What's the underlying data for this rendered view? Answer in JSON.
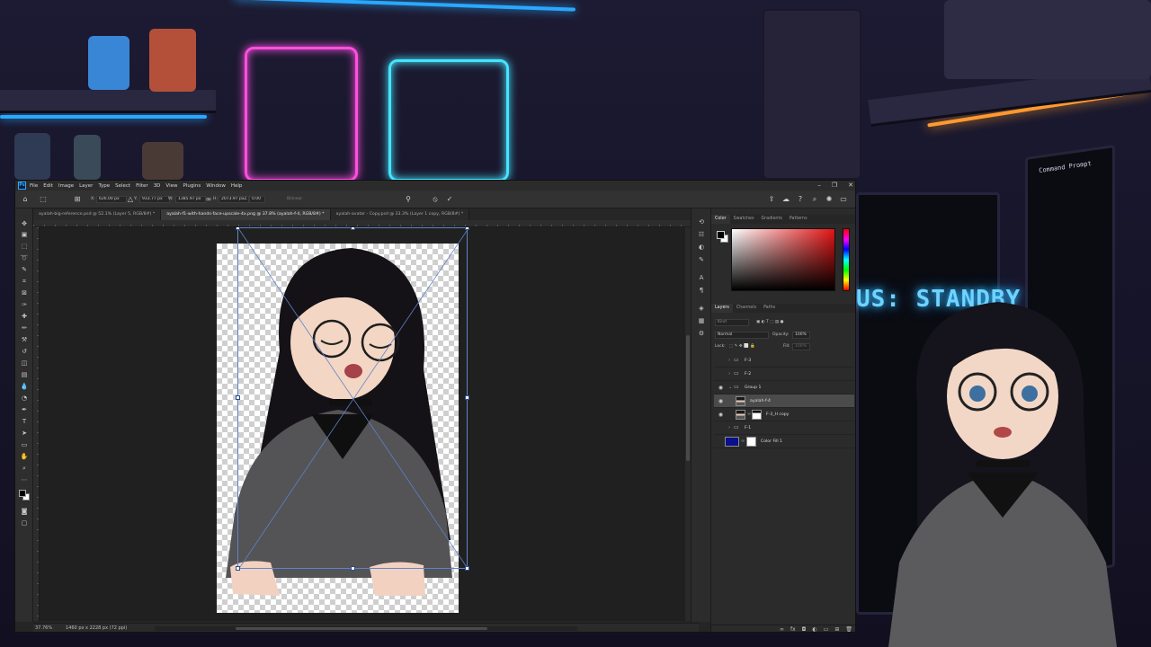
{
  "background": {
    "status_text": "US: STANDBY",
    "terminal_title": "Command Prompt",
    "colors": {
      "neon_pink": "#ff4fe0",
      "neon_cyan": "#45e4ff",
      "neon_blue": "#29a8ff",
      "neon_orange": "#ff9a2e"
    }
  },
  "app": {
    "logo": "Ps",
    "menu": [
      "File",
      "Edit",
      "Image",
      "Layer",
      "Type",
      "Select",
      "Filter",
      "3D",
      "View",
      "Plugins",
      "Window",
      "Help"
    ],
    "window_controls": {
      "minimize": "–",
      "restore": "❐",
      "close": "✕"
    }
  },
  "options_bar": {
    "x_label": "X:",
    "x_value": "626.00 px",
    "y_label": "Y:",
    "y_value": "933.77 px",
    "w_label": "W:",
    "w_value": "1385.97 px",
    "h_label": "H:",
    "h_value": "2073.97 px",
    "angle_label": "∠",
    "angle_value": "0.00",
    "interpolation": "Bilinear",
    "cancel_icon": "⦸",
    "commit_icon": "✓"
  },
  "tabs": [
    {
      "label": "ayalah-big-reference.psd @ 52.1% (Layer 5, RGB/8#) *",
      "active": false
    },
    {
      "label": "ayalah-f1-with-hands-face-upscale-4x.png @ 37.8% (ayalah-f-4, RGB/8#) *",
      "active": true
    },
    {
      "label": "ayalah-avatar - Copy.psd @ 33.3% (Layer 1 copy, RGB/8#) *",
      "active": false
    }
  ],
  "status_bar": {
    "zoom": "37.76%",
    "doc_info": "1460 px x 2228 px (72 ppi)"
  },
  "color_panel": {
    "tabs": [
      "Color",
      "Swatches",
      "Gradients",
      "Patterns"
    ],
    "foreground": "#000000",
    "background": "#ffffff",
    "hue": "#e41414"
  },
  "layers_panel": {
    "tabs": [
      "Layers",
      "Channels",
      "Paths"
    ],
    "filter_placeholder": "Kind",
    "blend_mode": "Normal",
    "opacity_label": "Opacity:",
    "opacity_value": "100%",
    "lock_label": "Lock:",
    "fill_label": "Fill:",
    "fill_value": "100%",
    "layers": [
      {
        "name": "F-3",
        "type": "group",
        "visible": false,
        "selected": false
      },
      {
        "name": "F-2",
        "type": "group",
        "visible": false,
        "selected": false
      },
      {
        "name": "Group 1",
        "type": "group",
        "visible": true,
        "selected": false
      },
      {
        "name": "ayalah-f-4",
        "type": "pixel",
        "visible": true,
        "selected": true
      },
      {
        "name": "F-3_H copy",
        "type": "masked",
        "visible": true,
        "selected": false
      },
      {
        "name": "F-1",
        "type": "group",
        "visible": false,
        "selected": false
      },
      {
        "name": "Color Fill 1",
        "type": "fill",
        "visible": false,
        "selected": false,
        "fill_color": "#0a0f8a"
      }
    ],
    "footer_icons": [
      "link-icon",
      "fx-icon",
      "mask-icon",
      "adjustment-icon",
      "group-icon",
      "new-layer-icon",
      "trash-icon"
    ]
  }
}
